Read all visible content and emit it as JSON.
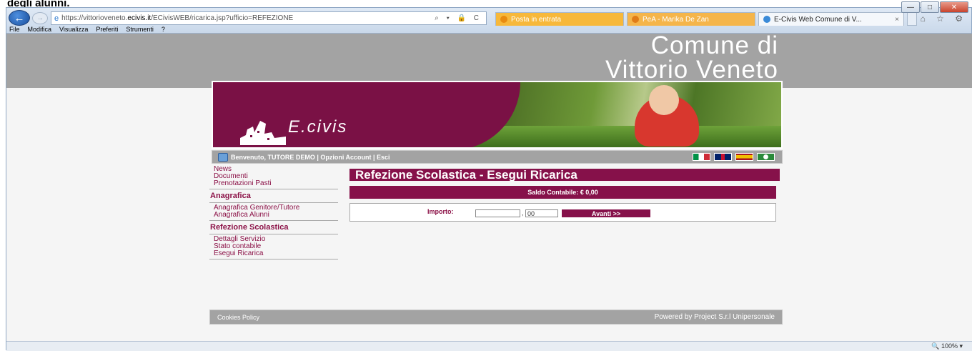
{
  "caption": "degli alunni.",
  "browser": {
    "url_prefix": "https://vittorioveneto.",
    "url_domain": "ecivis.it",
    "url_rest": "/ECivisWEB/ricarica.jsp?ufficio=REFEZIONE",
    "address_tools": "⌕ ▾ 🔒 C",
    "tabs": [
      {
        "label": "Posta in entrata"
      },
      {
        "label": "PeA - Marika De Zan"
      },
      {
        "label": "E-Civis Web Comune di V...",
        "close": "×"
      }
    ],
    "menu": [
      "File",
      "Modifica",
      "Visualizza",
      "Preferiti",
      "Strumenti",
      "?"
    ],
    "zoom": "🔍 100%  ▾",
    "window_controls": [
      "—",
      "□",
      "✕"
    ],
    "right_icons": "⌂ ☆ ⚙"
  },
  "site": {
    "comune_line1": "Comune di",
    "comune_line2": "Vittorio Veneto",
    "logo_text": "E.civis",
    "welcome": "Benvenuto, TUTORE DEMO | Opzioni Account   | Esci"
  },
  "sidebar": {
    "links_top": [
      "News",
      "Documenti",
      "Prenotazioni Pasti"
    ],
    "section1": "Anagrafica",
    "links_anagrafica": [
      "Anagrafica Genitore/Tutore",
      "Anagrafica Alunni"
    ],
    "section2": "Refezione Scolastica",
    "links_refezione": [
      "Dettagli Servizio",
      "Stato contabile",
      "Esegui Ricarica"
    ]
  },
  "main": {
    "title": "Refezione Scolastica - Esegui Ricarica",
    "saldo": "Saldo Contabile: € 0,00",
    "importo_label": "Importo:",
    "importo_int": "",
    "comma": ",",
    "importo_dec": "00",
    "avanti_label": "Avanti >>"
  },
  "footer": {
    "cookies": "Cookies Policy",
    "powered": "Powered by Project S.r.l Unipersonale"
  },
  "colors": {
    "brand_plum": "#86114a",
    "banner_grey": "#a3a3a3"
  }
}
